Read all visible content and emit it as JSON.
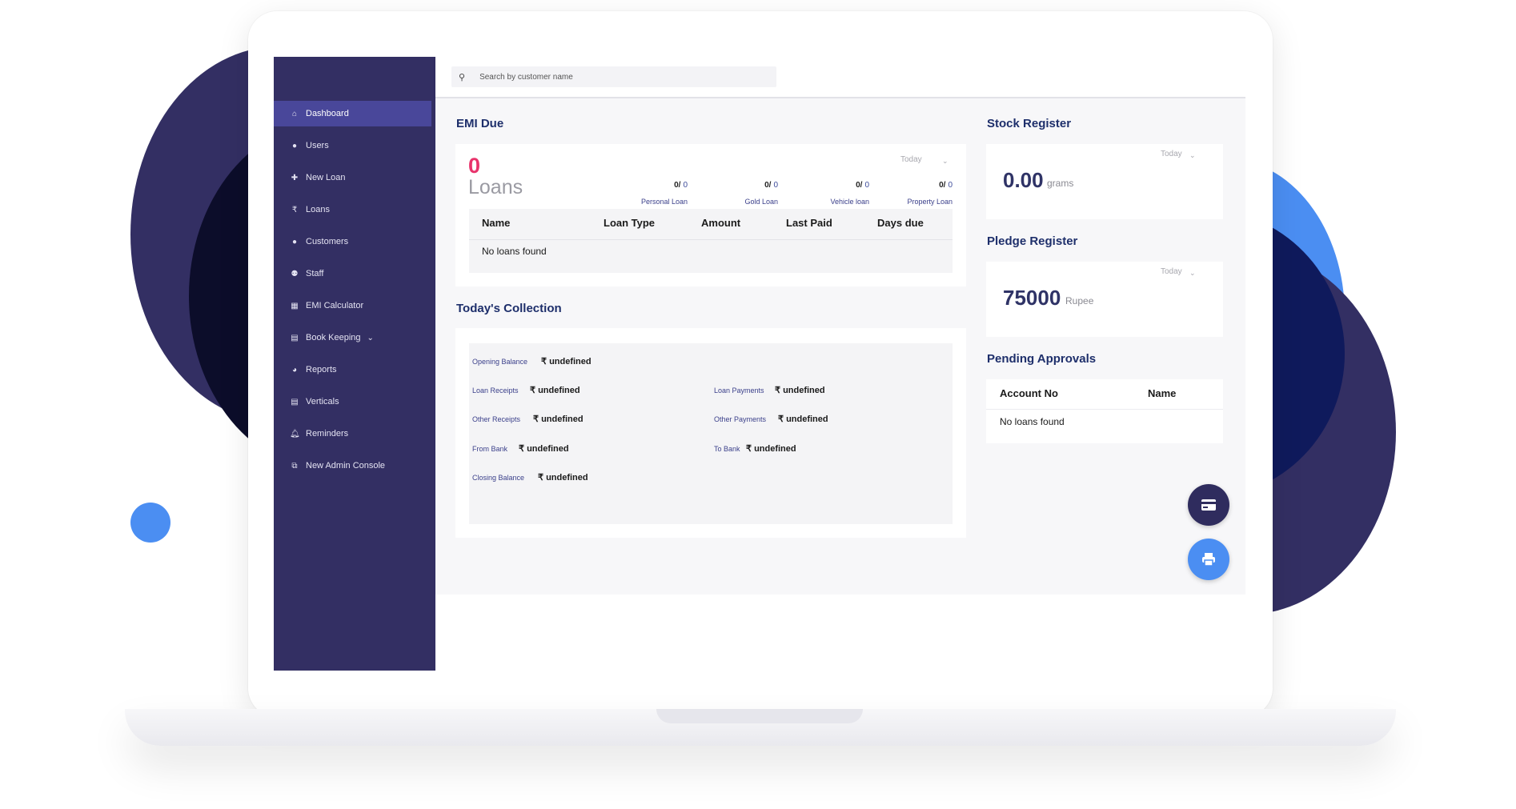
{
  "search": {
    "placeholder": "Search by customer name"
  },
  "sidebar": {
    "items": [
      {
        "label": "Dashboard",
        "icon": "home-icon",
        "glyph": "⌂"
      },
      {
        "label": "Users",
        "icon": "user-icon",
        "glyph": "●"
      },
      {
        "label": "New Loan",
        "icon": "plus-icon",
        "glyph": "✚"
      },
      {
        "label": "Loans",
        "icon": "rupee-icon",
        "glyph": "₹"
      },
      {
        "label": "Customers",
        "icon": "user-icon",
        "glyph": "●"
      },
      {
        "label": "Staff",
        "icon": "users-icon",
        "glyph": "⚉"
      },
      {
        "label": "EMI Calculator",
        "icon": "calculator-icon",
        "glyph": "▦"
      },
      {
        "label": "Book Keeping",
        "icon": "book-icon",
        "glyph": "▤"
      },
      {
        "label": "Reports",
        "icon": "chart-icon",
        "glyph": "◕"
      },
      {
        "label": "Verticals",
        "icon": "book-icon",
        "glyph": "▤"
      },
      {
        "label": "Reminders",
        "icon": "bell-icon",
        "glyph": "🔔︎"
      },
      {
        "label": "New Admin Console",
        "icon": "external-link-icon",
        "glyph": "⧉"
      }
    ]
  },
  "emi_due": {
    "title": "EMI Due",
    "count": "0",
    "count_label": "Loans",
    "filter": "Today",
    "loan_types": [
      {
        "num": "0/",
        "den": "0",
        "label": "Personal Loan"
      },
      {
        "num": "0/",
        "den": "0",
        "label": "Gold Loan"
      },
      {
        "num": "0/",
        "den": "0",
        "label": "Vehicle loan"
      },
      {
        "num": "0/",
        "den": "0",
        "label": "Property Loan"
      }
    ],
    "table": {
      "headers": [
        "Name",
        "Loan Type",
        "Amount",
        "Last Paid",
        "Days due"
      ],
      "empty": "No loans found"
    }
  },
  "collection": {
    "title": "Today's Collection",
    "currency": "₹",
    "rows": [
      {
        "label": "Opening Balance",
        "value": "undefined"
      },
      {
        "label": "Loan Receipts",
        "value": "undefined"
      },
      {
        "label": "Loan Payments",
        "value": "undefined"
      },
      {
        "label": "Other Receipts",
        "value": "undefined"
      },
      {
        "label": "Other Payments",
        "value": "undefined"
      },
      {
        "label": "From Bank",
        "value": "undefined"
      },
      {
        "label": "To Bank",
        "value": "undefined"
      },
      {
        "label": "Closing Balance",
        "value": "undefined"
      }
    ]
  },
  "stock": {
    "title": "Stock Register",
    "filter": "Today",
    "value": "0.00",
    "unit": "grams"
  },
  "pledge": {
    "title": "Pledge Register",
    "filter": "Today",
    "value": "75000",
    "unit": "Rupee"
  },
  "pending": {
    "title": "Pending Approvals",
    "headers": [
      "Account No",
      "Name"
    ],
    "empty": "No loans found"
  },
  "fab": {
    "card_icon": "credit-card-icon",
    "print_icon": "print-icon"
  },
  "colors": {
    "sidebar": "#332f63",
    "sidebar_active": "#49479a",
    "accent_pink": "#e8336b",
    "heading_blue": "#1e2f6b",
    "fab_dark": "#2f2c5e",
    "fab_blue": "#4b8ef2"
  }
}
